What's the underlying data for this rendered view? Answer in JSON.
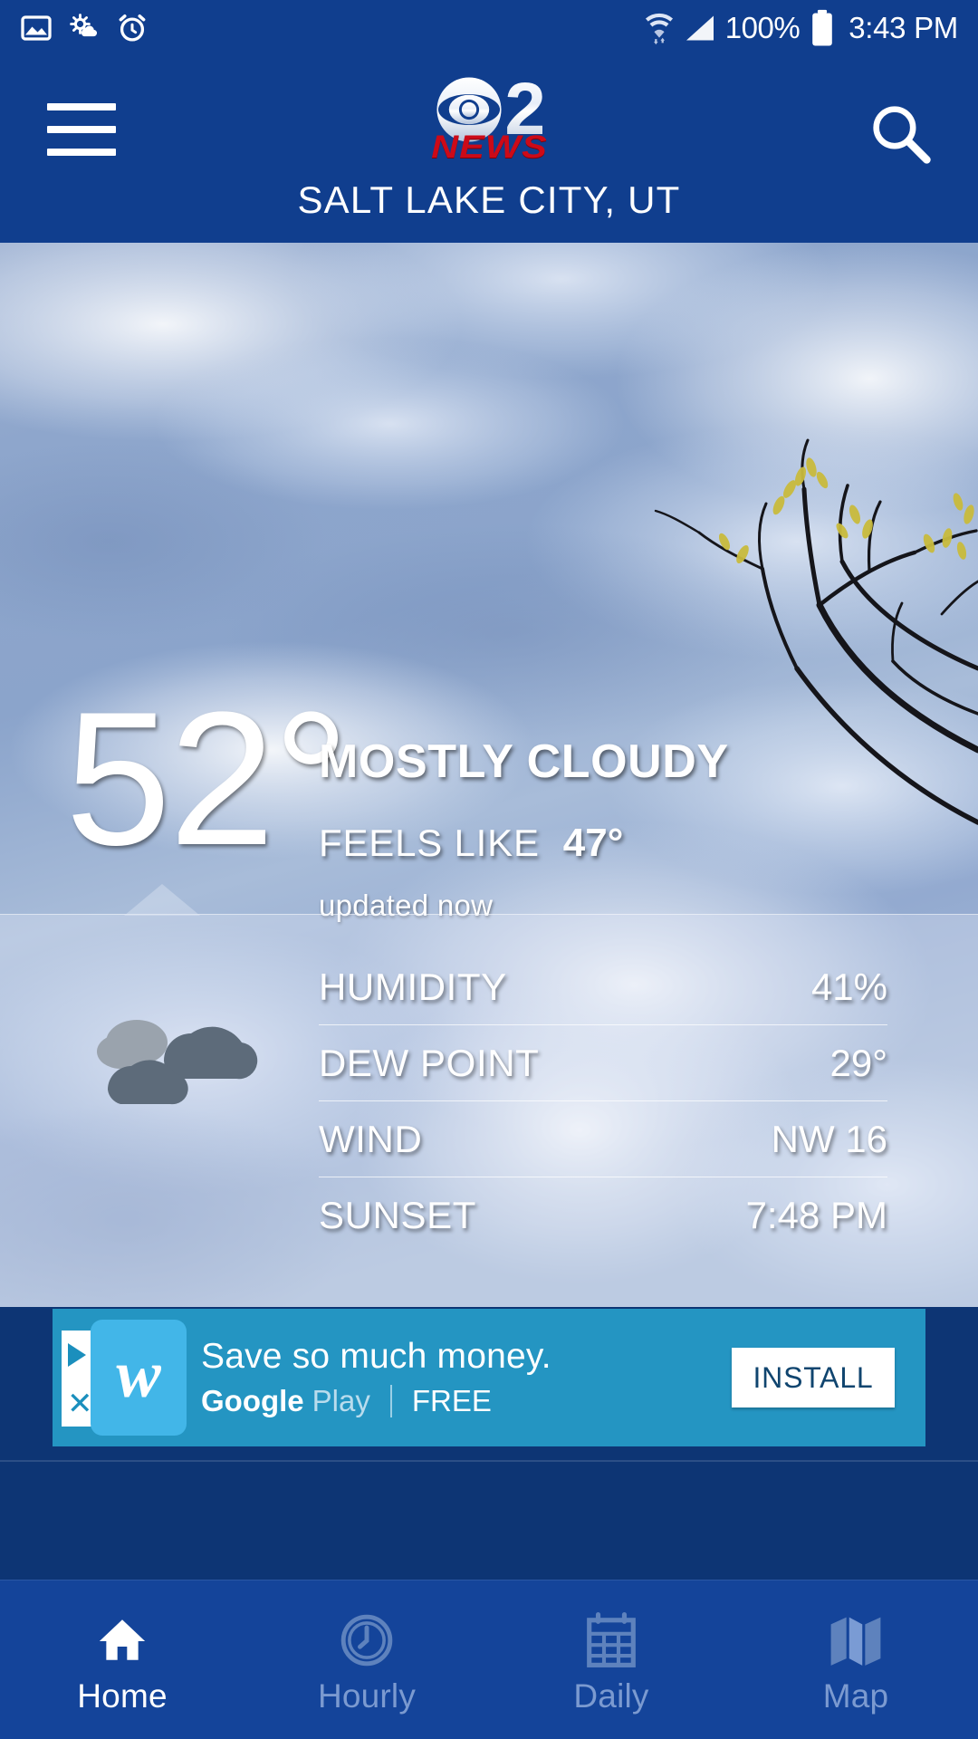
{
  "status_bar": {
    "icons_left": [
      "image-icon",
      "weather-sync-icon",
      "alarm-icon"
    ],
    "icons_right": [
      "wifi-icon",
      "signal-icon",
      "battery-icon"
    ],
    "battery": "100%",
    "time": "3:43 PM"
  },
  "header": {
    "menu_icon": "hamburger-menu-icon",
    "search_icon": "search-icon",
    "logo_number": "2",
    "logo_news": "NEWS",
    "logo_eye": "cbs-eye-icon",
    "city": "SALT LAKE CITY, UT"
  },
  "current": {
    "temperature": "52°",
    "condition": "MOSTLY CLOUDY",
    "feels_like_label": "FEELS LIKE",
    "feels_like_value": "47°",
    "updated": "updated now",
    "condition_icon": "cloudy-icon"
  },
  "details": {
    "rows": [
      {
        "label": "HUMIDITY",
        "value": "41%"
      },
      {
        "label": "DEW POINT",
        "value": "29°"
      },
      {
        "label": "WIND",
        "value": "NW 16"
      },
      {
        "label": "SUNSET",
        "value": "7:48 PM"
      }
    ]
  },
  "ad": {
    "headline": "Save so much money.",
    "store": "Google",
    "store_light": "Play",
    "price": "FREE",
    "cta": "INSTALL",
    "app_letter": "w",
    "close_icon": "close-ad-icon",
    "info_icon": "ad-info-icon",
    "bg_color": "#2495c2"
  },
  "bottom_nav": {
    "items": [
      {
        "label": "Home",
        "icon": "home-icon",
        "active": true
      },
      {
        "label": "Hourly",
        "icon": "clock-icon",
        "active": false
      },
      {
        "label": "Daily",
        "icon": "calendar-icon",
        "active": false
      },
      {
        "label": "Map",
        "icon": "map-icon",
        "active": false
      }
    ]
  },
  "theme": {
    "header_blue": "#103e8e",
    "nav_blue": "#14449a",
    "news_red": "#cc0a18",
    "ad_teal": "#2495c2"
  }
}
